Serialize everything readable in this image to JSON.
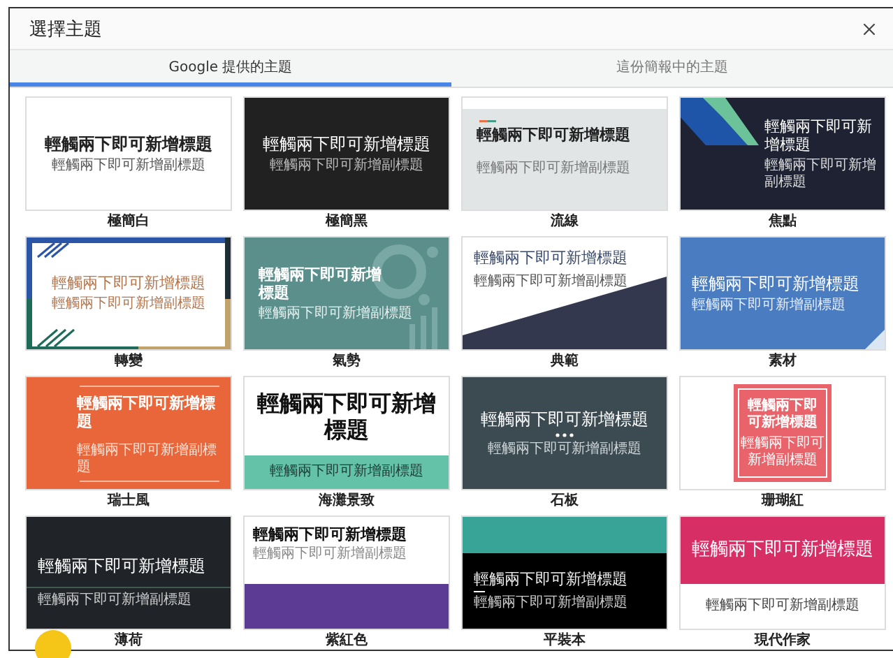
{
  "dialog": {
    "title": "選擇主題"
  },
  "tabs": [
    {
      "label": "Google 提供的主題",
      "selected": true
    },
    {
      "label": "這份簡報中的主題",
      "selected": false
    }
  ],
  "themes": [
    {
      "name": "極簡白",
      "kind": "light",
      "title": "輕觸兩下即可新增標題",
      "subtitle": "輕觸兩下即可新增副標題"
    },
    {
      "name": "極簡黑",
      "kind": "dark",
      "title": "輕觸兩下即可新增標題",
      "subtitle": "輕觸兩下即可新增副標題"
    },
    {
      "name": "流線",
      "kind": "streamline",
      "title": "輕觸兩下即可新增標題",
      "subtitle": "輕觸兩下即可新增副標題"
    },
    {
      "name": "焦點",
      "kind": "focus",
      "title": "輕觸兩下即可新增標題",
      "subtitle": "輕觸兩下即可新增副標題"
    },
    {
      "name": "轉變",
      "kind": "shift",
      "title": "輕觸兩下即可新增標題",
      "subtitle": "輕觸兩下即可新增副標題"
    },
    {
      "name": "氣勢",
      "kind": "momentum",
      "title": "輕觸兩下即可新增標題",
      "subtitle": "輕觸兩下即可新增副標題"
    },
    {
      "name": "典範",
      "kind": "paradigm",
      "title": "輕觸兩下即可新增標題",
      "subtitle": "輕觸兩下即可新增副標題"
    },
    {
      "name": "素材",
      "kind": "material",
      "title": "輕觸兩下即可新增標題",
      "subtitle": "輕觸兩下即可新增副標題"
    },
    {
      "name": "瑞士風",
      "kind": "swiss",
      "title": "輕觸兩下即可新增標題",
      "subtitle": "輕觸兩下即可新增副標題"
    },
    {
      "name": "海灘景致",
      "kind": "beach",
      "title": "輕觸兩下即可新增標題",
      "subtitle": "輕觸兩下即可新增副標題"
    },
    {
      "name": "石板",
      "kind": "slate",
      "title": "輕觸兩下即可新增標題",
      "subtitle": "輕觸兩下即可新增副標題"
    },
    {
      "name": "珊瑚紅",
      "kind": "coral",
      "title": "輕觸兩下即可新增標題",
      "subtitle": "輕觸兩下即可新增副標題"
    },
    {
      "name": "薄荷",
      "kind": "spearmint",
      "title": "輕觸兩下即可新增標題",
      "subtitle": "輕觸兩下即可新增副標題"
    },
    {
      "name": "紫紅色",
      "kind": "plum",
      "title": "輕觸兩下即可新增標題",
      "subtitle": "輕觸兩下即可新增副標題"
    },
    {
      "name": "平裝本",
      "kind": "paperback",
      "title": "輕觸兩下即可新增標題",
      "subtitle": "輕觸兩下即可新增副標題"
    },
    {
      "name": "現代作家",
      "kind": "writer",
      "title": "輕觸兩下即可新增標題",
      "subtitle": "輕觸兩下即可新增副標題"
    }
  ]
}
